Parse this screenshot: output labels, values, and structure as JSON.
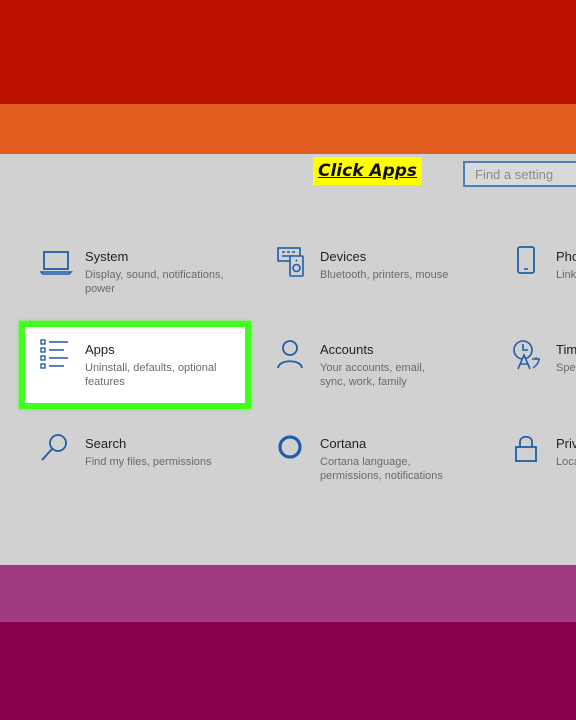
{
  "overlay": {
    "caption": "Click Apps"
  },
  "search": {
    "placeholder": "Find a setting"
  },
  "tiles": [
    {
      "title": "System",
      "desc": "Display, sound, notifications, power",
      "icon": "laptop-icon"
    },
    {
      "title": "Devices",
      "desc": "Bluetooth, printers, mouse",
      "icon": "keyboard-speaker-icon"
    },
    {
      "title": "Pho",
      "desc": "Link",
      "icon": "phone-icon"
    },
    {
      "title": "Apps",
      "desc": "Uninstall, defaults, optional features",
      "icon": "apps-list-icon",
      "highlighted": true
    },
    {
      "title": "Accounts",
      "desc": "Your accounts, email, sync, work, family",
      "icon": "person-icon"
    },
    {
      "title": "Tim",
      "desc": "Spe",
      "icon": "time-language-icon"
    },
    {
      "title": "Search",
      "desc": "Find my files, permissions",
      "icon": "search-icon"
    },
    {
      "title": "Cortana",
      "desc": "Cortana language, permissions, notifications",
      "icon": "cortana-icon"
    },
    {
      "title": "Priv",
      "desc": "Loca",
      "icon": "lock-icon"
    }
  ],
  "colors": {
    "accent": "#1f5fa8",
    "highlight": "#41ff1c",
    "caption_bg": "#ffff00",
    "panel_bg": "#d1d1d1"
  }
}
